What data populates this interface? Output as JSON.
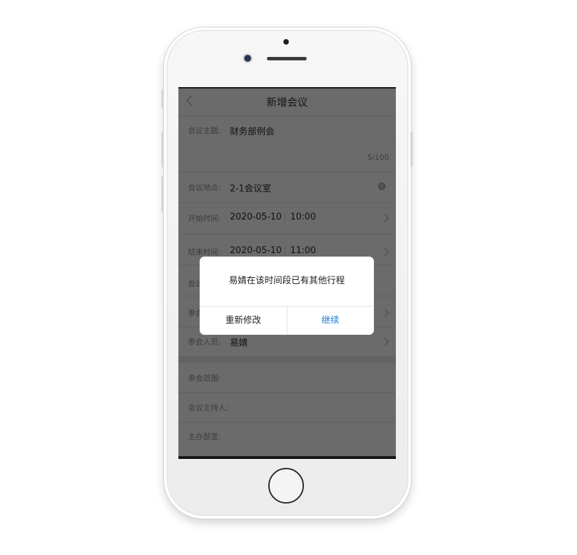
{
  "header": {
    "title": "新增会议"
  },
  "form": {
    "topic": {
      "label": "会议主题:",
      "value": "财务部例会",
      "counter": "5/100"
    },
    "location": {
      "label": "会议地点:",
      "value": "2-1会议室"
    },
    "start": {
      "label": "开始时间:",
      "date": "2020-05-10",
      "time": "10:00"
    },
    "end": {
      "label": "结束时间:",
      "date": "2020-05-10",
      "time": "11:00"
    },
    "row5": {
      "label": "会议"
    },
    "row6": {
      "label": "参会"
    },
    "attendees": {
      "label": "参会人员:",
      "value": "易婧"
    },
    "scope": {
      "label": "参会范围:"
    },
    "host": {
      "label": "会议主持人:"
    },
    "dept": {
      "label": "主办部室:"
    }
  },
  "dialog": {
    "message": "易婧在该时间段已有其他行程",
    "cancel_label": "重新修改",
    "confirm_label": "继续"
  },
  "colors": {
    "overlay": "#6b6b6b",
    "confirm_accent": "#1f7fd8",
    "frame": "#eeeeee"
  }
}
